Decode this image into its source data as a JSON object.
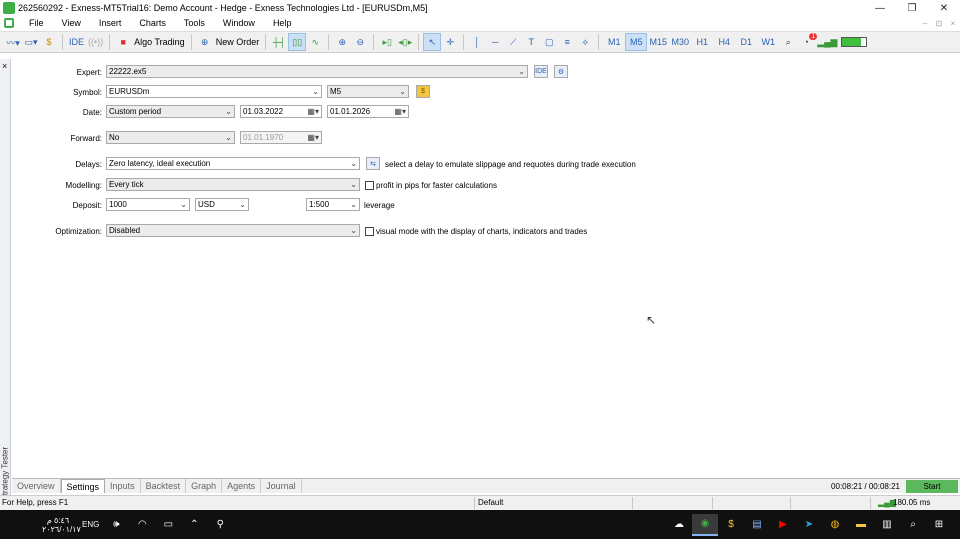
{
  "window": {
    "title": "262560292 - Exness-MT5Trial16: Demo Account - Hedge - Exness Technologies Ltd - [EURUSDm,M5]",
    "minimize": "—",
    "restore": "❐",
    "close": "✕"
  },
  "menu": {
    "items": [
      "File",
      "View",
      "Insert",
      "Charts",
      "Tools",
      "Window",
      "Help"
    ],
    "mdi": [
      "–",
      "⊡",
      "×"
    ]
  },
  "toolbar": {
    "algo_trading": "Algo Trading",
    "new_order": "New Order",
    "ide": "IDE",
    "timeframes": [
      "M1",
      "M5",
      "M15",
      "M30",
      "H1",
      "H4",
      "D1",
      "W1"
    ],
    "selected_timeframe": "M5",
    "notification_count": "1"
  },
  "side_panel": {
    "close": "×",
    "vertical_title": "Strategy Tester"
  },
  "form": {
    "expert_label": "Expert:",
    "expert_value": "22222.ex5",
    "symbol_label": "Symbol:",
    "symbol_value": "EURUSDm",
    "timeframe_value": "M5",
    "date_label": "Date:",
    "date_mode": "Custom period",
    "date_from": "01.03.2022",
    "date_to": "01.01.2026",
    "forward_label": "Forward:",
    "forward_value": "No",
    "forward_date": "01.01.1970",
    "delays_label": "Delays:",
    "delays_value": "Zero latency, ideal execution",
    "delays_note": "select a delay to emulate slippage and requotes during trade execution",
    "modelling_label": "Modelling:",
    "modelling_value": "Every tick",
    "modelling_note": "profit in pips for faster calculations",
    "deposit_label": "Deposit:",
    "deposit_value": "1000",
    "currency_value": "USD",
    "leverage_value": "1:500",
    "leverage_note": "leverage",
    "optimization_label": "Optimization:",
    "optimization_value": "Disabled",
    "visual_note": "visual mode with the display of charts, indicators and trades"
  },
  "tabs": {
    "items": [
      "Overview",
      "Settings",
      "Inputs",
      "Backtest",
      "Graph",
      "Agents",
      "Journal"
    ],
    "active": "Settings",
    "timer": "00:08:21 / 00:08:21",
    "start": "Start"
  },
  "status": {
    "help": "For Help, press F1",
    "profile": "Default",
    "ping": "180.05 ms"
  },
  "taskbar": {
    "time": "٥:٤٦ م",
    "date": "٢٠٢٦/٠١/١٧",
    "lang": "ENG"
  }
}
